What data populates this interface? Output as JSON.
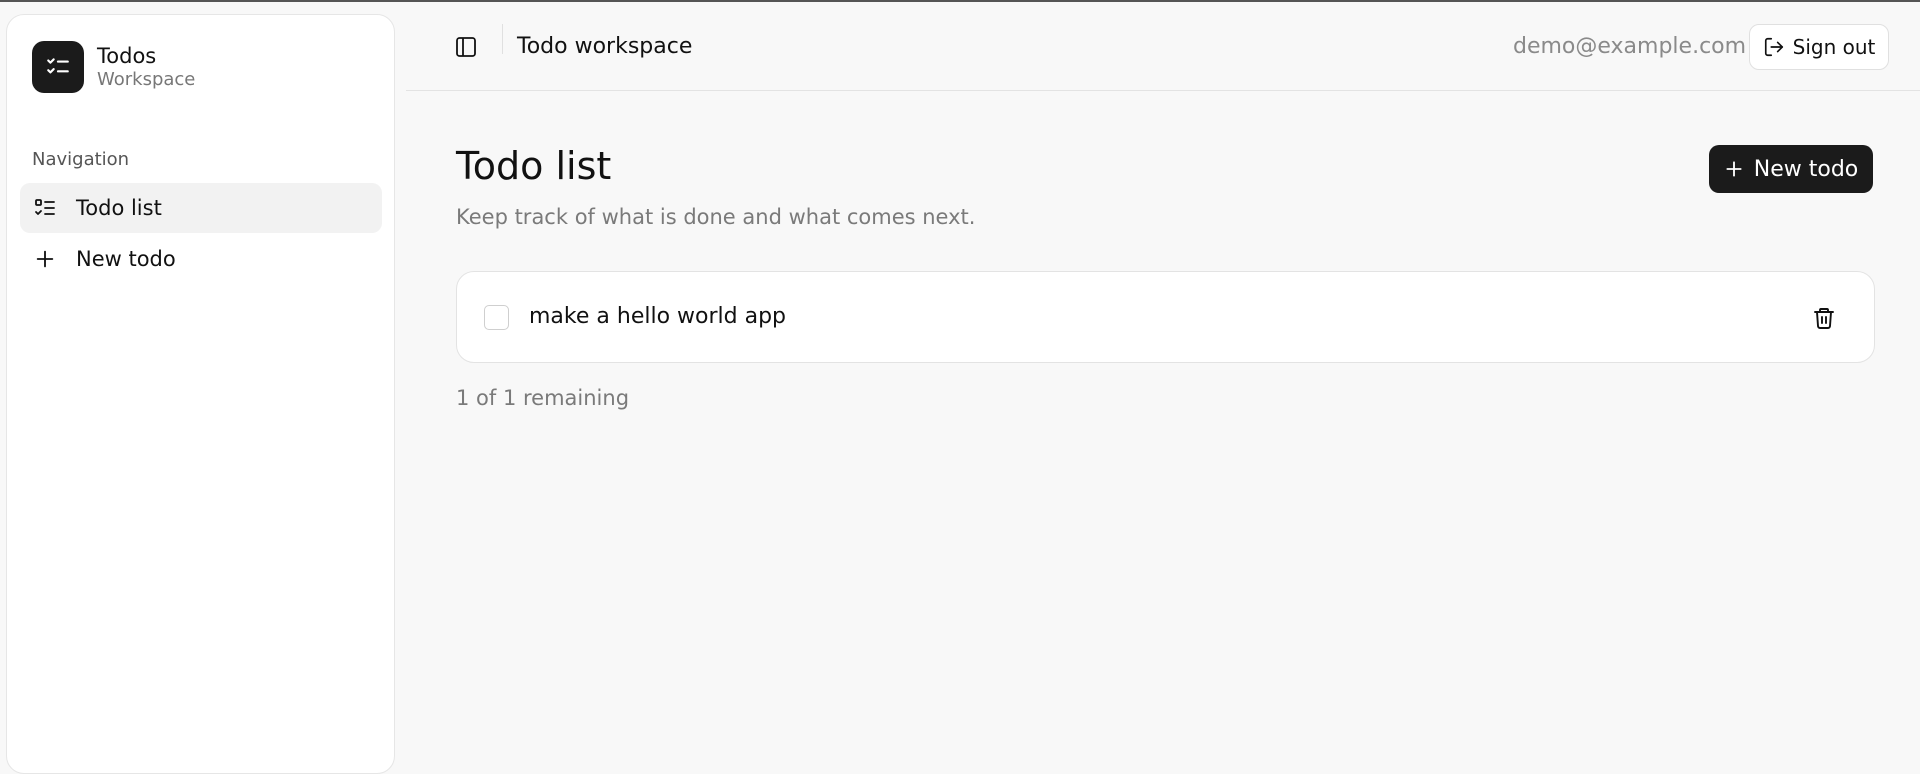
{
  "brand": {
    "name": "Todos",
    "subtitle": "Workspace",
    "logo_icon": "checklist-icon"
  },
  "sidebar": {
    "section_label": "Navigation",
    "items": [
      {
        "label": "Todo list",
        "icon": "list-check-icon",
        "active": true
      },
      {
        "label": "New todo",
        "icon": "plus-icon",
        "active": false
      }
    ]
  },
  "header": {
    "toggle_icon": "sidebar-toggle-icon",
    "title": "Todo workspace",
    "user_email": "demo@example.com",
    "signout_label": "Sign out",
    "signout_icon": "sign-out-icon"
  },
  "main": {
    "title": "Todo list",
    "subtitle": "Keep track of what is done and what comes next.",
    "new_todo_label": "New todo",
    "todos": [
      {
        "text": "make a hello world app",
        "done": false
      }
    ],
    "remaining_text": "1 of 1 remaining"
  },
  "colors": {
    "accent": "#1b1b1b",
    "background": "#f8f8f8",
    "muted_text": "#7a7a7a",
    "border": "#e3e3e3"
  }
}
